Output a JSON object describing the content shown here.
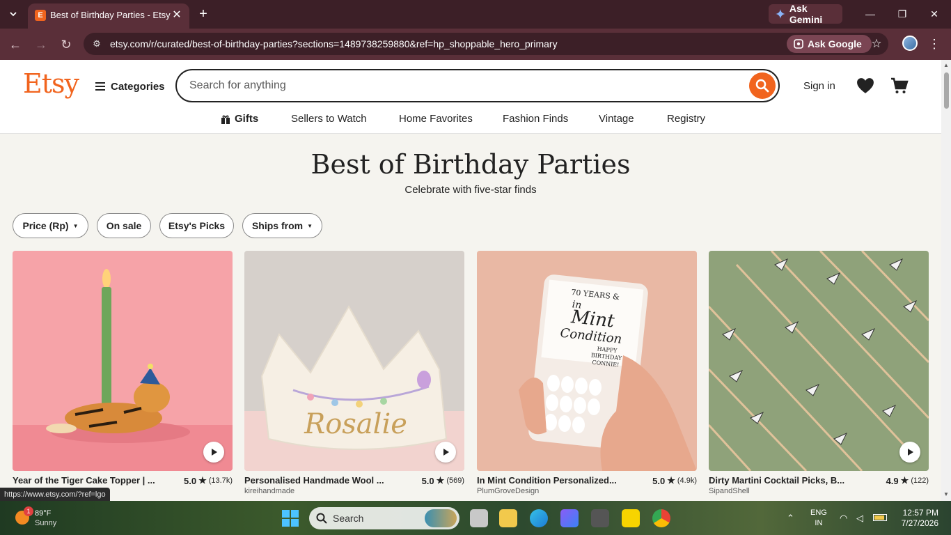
{
  "browser": {
    "tab_title": "Best of Birthday Parties - Etsy",
    "tab_favicon_letter": "E",
    "ask_gemini": "Ask Gemini",
    "url": "etsy.com/r/curated/best-of-birthday-parties?sections=1489738259880&ref=hp_shoppable_hero_primary",
    "ask_google": "Ask Google",
    "status_url": "https://www.etsy.com/?ref=lgo"
  },
  "header": {
    "logo": "Etsy",
    "categories": "Categories",
    "search_placeholder": "Search for anything",
    "sign_in": "Sign in"
  },
  "subnav": [
    "Gifts",
    "Sellers to Watch",
    "Home Favorites",
    "Fashion Finds",
    "Vintage",
    "Registry"
  ],
  "hero": {
    "title": "Best of Birthday Parties",
    "subtitle": "Celebrate with five-star finds"
  },
  "filters": [
    "Price (Rp)",
    "On sale",
    "Etsy's Picks",
    "Ships from"
  ],
  "products": [
    {
      "title": "Year of the Tiger Cake Topper | ...",
      "rating": "5.0",
      "count": "(13.7k)",
      "shop": ""
    },
    {
      "title": "Personalised Handmade Wool ...",
      "rating": "5.0",
      "count": "(569)",
      "shop": "kireihandmade"
    },
    {
      "title": "In Mint Condition Personalized...",
      "rating": "5.0",
      "count": "(4.9k)",
      "shop": "PlumGroveDesign"
    },
    {
      "title": "Dirty Martini Cocktail Picks, B...",
      "rating": "4.9",
      "count": "(122)",
      "shop": "SipandShell"
    }
  ],
  "product_art": {
    "mint_line1": "70 YEARS &",
    "mint_line2": "in",
    "mint_line3": "Mint",
    "mint_line4": "Condition",
    "mint_line5": "HAPPY",
    "mint_line6": "BIRTHDAY",
    "mint_line7": "CONNIE!",
    "crown_name": "Rosalie"
  },
  "taskbar": {
    "weather_temp": "89°F",
    "weather_day": "Sunny",
    "weather_badge": "1",
    "search": "Search",
    "lang1": "ENG",
    "lang2": "IN",
    "time": "12:57 PM",
    "date": "7/27/2026"
  },
  "colors": {
    "etsy_orange": "#f1641e",
    "chrome_dark": "#3c1f27",
    "chrome_mid": "#5a2f39",
    "hero_bg": "#f5f4ef"
  }
}
